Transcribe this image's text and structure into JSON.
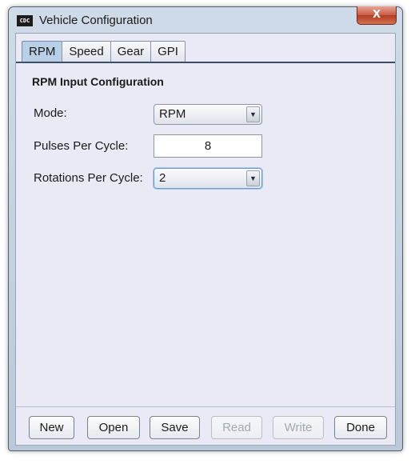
{
  "window": {
    "title": "Vehicle Configuration",
    "app_icon_text": "CDC",
    "close_glyph": "X"
  },
  "tabs": [
    {
      "label": "RPM",
      "active": true
    },
    {
      "label": "Speed",
      "active": false
    },
    {
      "label": "Gear",
      "active": false
    },
    {
      "label": "GPI",
      "active": false
    }
  ],
  "panel": {
    "title": "RPM Input Configuration",
    "mode": {
      "label": "Mode:",
      "value": "RPM"
    },
    "pulses": {
      "label": "Pulses Per Cycle:",
      "value": "8"
    },
    "rotations": {
      "label": "Rotations Per Cycle:",
      "value": "2"
    }
  },
  "buttons": {
    "new": {
      "label": "New",
      "enabled": true
    },
    "open": {
      "label": "Open",
      "enabled": true
    },
    "save": {
      "label": "Save",
      "enabled": true
    },
    "read": {
      "label": "Read",
      "enabled": false
    },
    "write": {
      "label": "Write",
      "enabled": false
    },
    "done": {
      "label": "Done",
      "enabled": true
    }
  },
  "icons": {
    "dropdown_arrow": "▼"
  }
}
